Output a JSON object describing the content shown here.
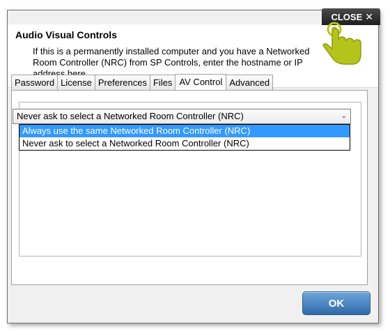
{
  "close_button": {
    "label": "CLOSE",
    "icon": "close-icon"
  },
  "header": {
    "title": "Audio Visual Controls",
    "description": "If this is a permanently installed computer and you have a Networked Room Controller (NRC) from SP Controls, enter the hostname or IP address here."
  },
  "tabs": [
    {
      "label": "Password"
    },
    {
      "label": "License"
    },
    {
      "label": "Preferences"
    },
    {
      "label": "Files"
    },
    {
      "label": "AV Control",
      "active": true
    },
    {
      "label": "Advanced"
    }
  ],
  "nrc_select": {
    "value": "Never ask to select a Networked Room Controller (NRC)",
    "options": [
      {
        "label": "Always use the same Networked Room Controller (NRC)",
        "highlighted": true
      },
      {
        "label": "Never ask to select a Networked Room Controller (NRC)"
      }
    ]
  },
  "ok_button": {
    "label": "OK"
  },
  "colors": {
    "accent_blue": "#3399ff",
    "ok_button": "#2f6aa8",
    "hand_icon": "#b5c41a"
  }
}
